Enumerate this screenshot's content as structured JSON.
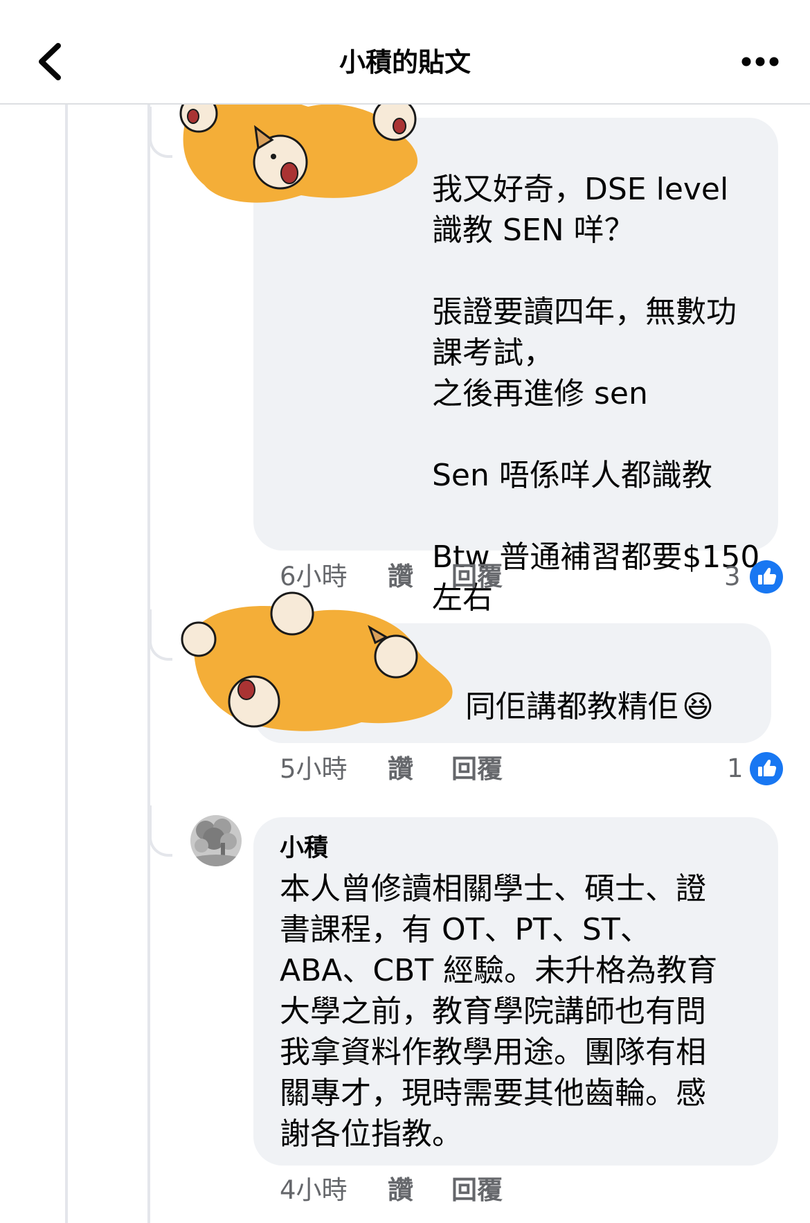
{
  "header": {
    "title": "小積的貼文",
    "back_icon": "chevron-left-icon",
    "more_icon": "more-horizontal-icon"
  },
  "comments": [
    {
      "author": "",
      "body": "我又好奇，DSE level\n識教 SEN 咩？\n\n張證要讀四年，無數功課考試，\n之後再進修 sen\n\nSen 唔係咩人都識教\n\nBtw 普通補習都要$150左右",
      "time": "6小時",
      "like_label": "讚",
      "reply_label": "回覆",
      "reaction_count": "3"
    },
    {
      "author": "",
      "body": "同佢講都教精佢",
      "emoji": "😆",
      "time": "5小時",
      "like_label": "讚",
      "reply_label": "回覆",
      "reaction_count": "1"
    },
    {
      "author": "小積",
      "body": "本人曾修讀相關學士、碩士、證\n書課程，有 OT、PT、ST、\nABA、CBT 經驗。未升格為教育\n大學之前，教育學院講師也有問\n我拿資料作教學用途。團隊有相\n關專才，現時需要其他齒輪。感\n謝各位指教。",
      "time": "4小時",
      "like_label": "讚",
      "reply_label": "回覆"
    }
  ],
  "colors": {
    "bubble": "#f0f2f5",
    "meta_text": "#65676b",
    "like_blue": "#1877f2",
    "redaction_orange": "#f4ae38",
    "thread_line": "#e4e6eb"
  }
}
